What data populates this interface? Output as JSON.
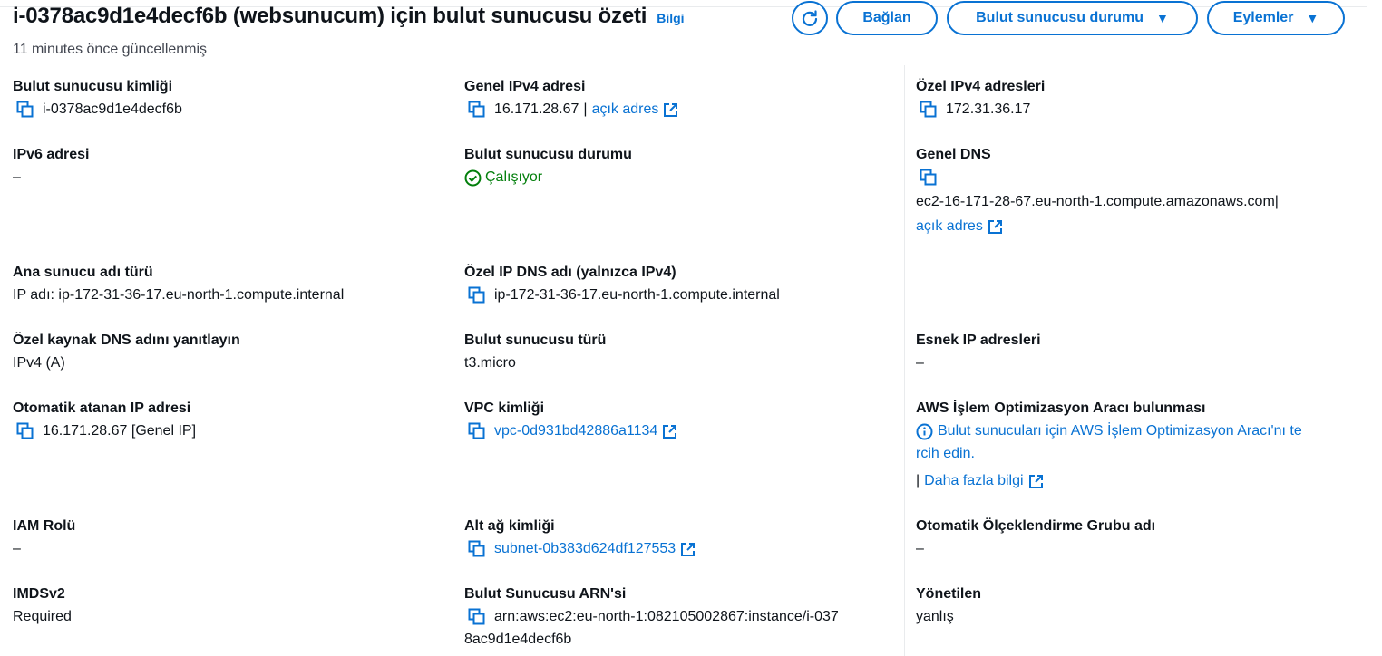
{
  "header": {
    "title": "i-0378ac9d1e4decf6b (websunucum) için bulut sunucusu özeti",
    "info_link": "Bilgi",
    "updated": "11 minutes önce güncellenmiş"
  },
  "toolbar": {
    "refresh_icon": "refresh-icon",
    "connect_label": "Bağlan",
    "instance_state_label": "Bulut sunucusu durumu",
    "actions_label": "Eylemler"
  },
  "colors": {
    "link": "#0972d3",
    "success": "#037f0c",
    "text": "#0f141a",
    "secondary": "#424650"
  },
  "column1": {
    "instance_id": {
      "label": "Bulut sunucusu kimliği",
      "value": "i-0378ac9d1e4decf6b"
    },
    "ipv6": {
      "label": "IPv6 adresi",
      "value": "–"
    },
    "hostname_type": {
      "label": "Ana sunucu adı türü",
      "value": "IP adı: ip-172-31-36-17.eu-north-1.compute.internal"
    },
    "resource_dns": {
      "label": "Özel kaynak DNS adını yanıtlayın",
      "value": "IPv4 (A)"
    },
    "auto_ip": {
      "label": "Otomatik atanan IP adresi",
      "value": "16.171.28.67 [Genel IP]"
    },
    "iam_role": {
      "label": "IAM Rolü",
      "value": "–"
    },
    "imdsv2": {
      "label": "IMDSv2",
      "value": "Required"
    }
  },
  "column2": {
    "public_ipv4": {
      "label": "Genel IPv4 adresi",
      "value": "16.171.28.67",
      "separator": "|",
      "link": "açık adres"
    },
    "instance_state": {
      "label": "Bulut sunucusu durumu",
      "value": "Çalışıyor"
    },
    "private_dns": {
      "label": "Özel IP DNS adı (yalnızca IPv4)",
      "value": "ip-172-31-36-17.eu-north-1.compute.internal"
    },
    "instance_type": {
      "label": "Bulut sunucusu türü",
      "value": "t3.micro"
    },
    "vpc_id": {
      "label": "VPC kimliği",
      "value": "vpc-0d931bd42886a1134"
    },
    "subnet_id": {
      "label": "Alt ağ kimliği",
      "value": "subnet-0b383d624df127553"
    },
    "arn": {
      "label": "Bulut Sunucusu ARN'si",
      "value_line1": "arn:aws:ec2:eu-north-1:082105002867:instance/i-037",
      "value_line2": "8ac9d1e4decf6b"
    }
  },
  "column3": {
    "private_ipv4": {
      "label": "Özel IPv4 adresleri",
      "value": "172.31.36.17"
    },
    "public_dns": {
      "label": "Genel DNS",
      "value": "ec2-16-171-28-67.eu-north-1.compute.amazonaws.com",
      "separator": "|",
      "link": "açık adres"
    },
    "elastic_ip": {
      "label": "Esnek IP adresleri",
      "value": "–"
    },
    "optimizer": {
      "label": "AWS İşlem Optimizasyon Aracı bulunması",
      "message_line1": "Bulut sunucuları için AWS İşlem Optimizasyon Aracı'nı te",
      "message_line2": "rcih edin.",
      "separator": "|",
      "more_link": "Daha fazla bilgi"
    },
    "asg_name": {
      "label": "Otomatik Ölçeklendirme Grubu adı",
      "value": "–"
    },
    "managed": {
      "label": "Yönetilen",
      "value": "yanlış"
    }
  }
}
